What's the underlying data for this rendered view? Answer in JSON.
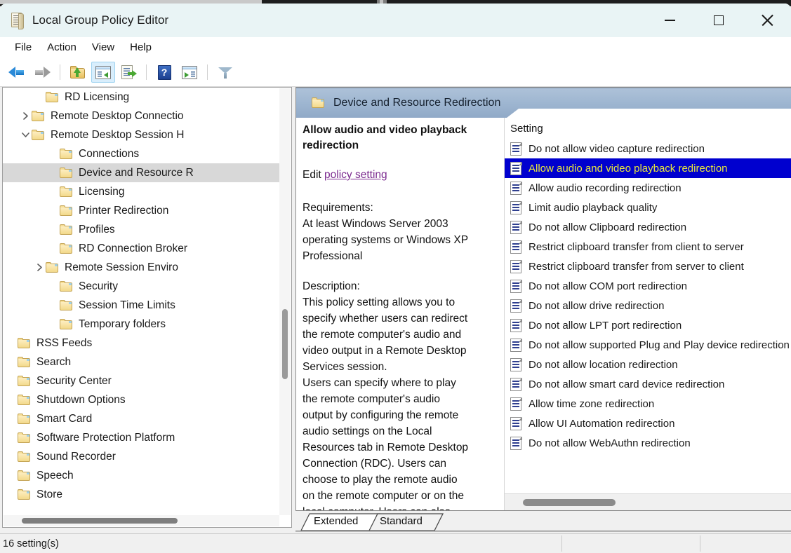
{
  "window": {
    "title": "Local Group Policy Editor",
    "app_icon": "scroll-policy-icon",
    "minimize_label": "Minimize",
    "maximize_label": "Maximize",
    "close_label": "Close"
  },
  "menu": {
    "items": [
      {
        "label": "File"
      },
      {
        "label": "Action"
      },
      {
        "label": "View"
      },
      {
        "label": "Help"
      }
    ]
  },
  "toolbar": {
    "buttons": [
      {
        "name": "back-button",
        "icon": "back-arrow-icon",
        "label": "Back"
      },
      {
        "name": "forward-button",
        "icon": "forward-arrow-icon",
        "label": "Forward"
      },
      {
        "name": "up-one-level-button",
        "icon": "folder-up-icon",
        "label": "Up One Level"
      },
      {
        "name": "show-hide-console-tree-button",
        "icon": "console-tree-icon",
        "label": "Show/Hide Console Tree"
      },
      {
        "name": "export-list-button",
        "icon": "export-list-icon",
        "label": "Export List"
      },
      {
        "name": "help-button",
        "icon": "help-question-icon",
        "label": "Help"
      },
      {
        "name": "show-hide-action-pane-button",
        "icon": "action-pane-icon",
        "label": "Show/Hide Action Pane"
      },
      {
        "name": "filter-button",
        "icon": "funnel-filter-icon",
        "label": "Filter"
      }
    ]
  },
  "tree": {
    "items": [
      {
        "label": "RD Licensing",
        "indent": 2,
        "expander": "none",
        "selected": false
      },
      {
        "label": "Remote Desktop Connectio",
        "indent": 1,
        "expander": "collapsed",
        "selected": false
      },
      {
        "label": "Remote Desktop Session H",
        "indent": 1,
        "expander": "expanded",
        "selected": false
      },
      {
        "label": "Connections",
        "indent": 3,
        "expander": "none",
        "selected": false
      },
      {
        "label": "Device and Resource R",
        "indent": 3,
        "expander": "none",
        "selected": true
      },
      {
        "label": "Licensing",
        "indent": 3,
        "expander": "none",
        "selected": false
      },
      {
        "label": "Printer Redirection",
        "indent": 3,
        "expander": "none",
        "selected": false
      },
      {
        "label": "Profiles",
        "indent": 3,
        "expander": "none",
        "selected": false
      },
      {
        "label": "RD Connection Broker",
        "indent": 3,
        "expander": "none",
        "selected": false
      },
      {
        "label": "Remote Session Enviro",
        "indent": 2,
        "expander": "collapsed",
        "selected": false
      },
      {
        "label": "Security",
        "indent": 3,
        "expander": "none",
        "selected": false
      },
      {
        "label": "Session Time Limits",
        "indent": 3,
        "expander": "none",
        "selected": false
      },
      {
        "label": "Temporary folders",
        "indent": 3,
        "expander": "none",
        "selected": false
      },
      {
        "label": "RSS Feeds",
        "indent": 0,
        "expander": "none",
        "selected": false
      },
      {
        "label": "Search",
        "indent": 0,
        "expander": "none",
        "selected": false
      },
      {
        "label": "Security Center",
        "indent": 0,
        "expander": "none",
        "selected": false
      },
      {
        "label": "Shutdown Options",
        "indent": 0,
        "expander": "none",
        "selected": false
      },
      {
        "label": "Smart Card",
        "indent": 0,
        "expander": "none",
        "selected": false
      },
      {
        "label": "Software Protection Platform",
        "indent": 0,
        "expander": "none",
        "selected": false
      },
      {
        "label": "Sound Recorder",
        "indent": 0,
        "expander": "none",
        "selected": false
      },
      {
        "label": "Speech",
        "indent": 0,
        "expander": "none",
        "selected": false
      },
      {
        "label": "Store",
        "indent": 0,
        "expander": "none",
        "selected": false
      }
    ]
  },
  "details": {
    "header_title": "Device and Resource Redirection",
    "header_icon": "folder-icon",
    "policy_title": "Allow audio and video playback redirection",
    "edit_prefix": "Edit",
    "edit_link": "policy setting ",
    "requirements_heading": "Requirements:",
    "requirements_text": "At least Windows Server 2003\noperating systems or Windows XP\nProfessional",
    "description_heading": "Description:",
    "description_text": "This policy setting allows you to\nspecify whether users can redirect\nthe remote computer's audio and\nvideo output in a Remote Desktop\nServices session.\nUsers can specify where to play\nthe remote computer's audio\noutput by configuring the remote\naudio settings on the Local\nResources tab in Remote Desktop\nConnection (RDC). Users can\nchoose to play the remote audio\non the remote computer or on the\nlocal computer. Users can also"
  },
  "settings_list": {
    "column_header": "Setting",
    "rows": [
      {
        "label": "Do not allow video capture redirection",
        "selected": false
      },
      {
        "label": "Allow audio and video playback redirection",
        "selected": true
      },
      {
        "label": "Allow audio recording redirection",
        "selected": false
      },
      {
        "label": "Limit audio playback quality",
        "selected": false
      },
      {
        "label": "Do not allow Clipboard redirection",
        "selected": false
      },
      {
        "label": "Restrict clipboard transfer from client to server",
        "selected": false
      },
      {
        "label": "Restrict clipboard transfer from server to client",
        "selected": false
      },
      {
        "label": "Do not allow COM port redirection",
        "selected": false
      },
      {
        "label": "Do not allow drive redirection",
        "selected": false
      },
      {
        "label": "Do not allow LPT port redirection",
        "selected": false
      },
      {
        "label": "Do not allow supported Plug and Play device redirection",
        "selected": false
      },
      {
        "label": "Do not allow location redirection",
        "selected": false
      },
      {
        "label": "Do not allow smart card device redirection",
        "selected": false
      },
      {
        "label": "Allow time zone redirection",
        "selected": false
      },
      {
        "label": "Allow UI Automation redirection",
        "selected": false
      },
      {
        "label": "Do not allow WebAuthn redirection",
        "selected": false
      }
    ]
  },
  "view_tabs": {
    "extended": "Extended",
    "standard": "Standard",
    "active": "Extended"
  },
  "status": {
    "count_text": "16 setting(s)"
  },
  "colors": {
    "titlebar_bg": "#e9f4f5",
    "selection_blue": "#0000cf",
    "selection_text": "#e8e83c",
    "tree_selection": "#d8d8d8",
    "header_blue": "#9ab3cf",
    "link_purple": "#7b2a8f"
  }
}
